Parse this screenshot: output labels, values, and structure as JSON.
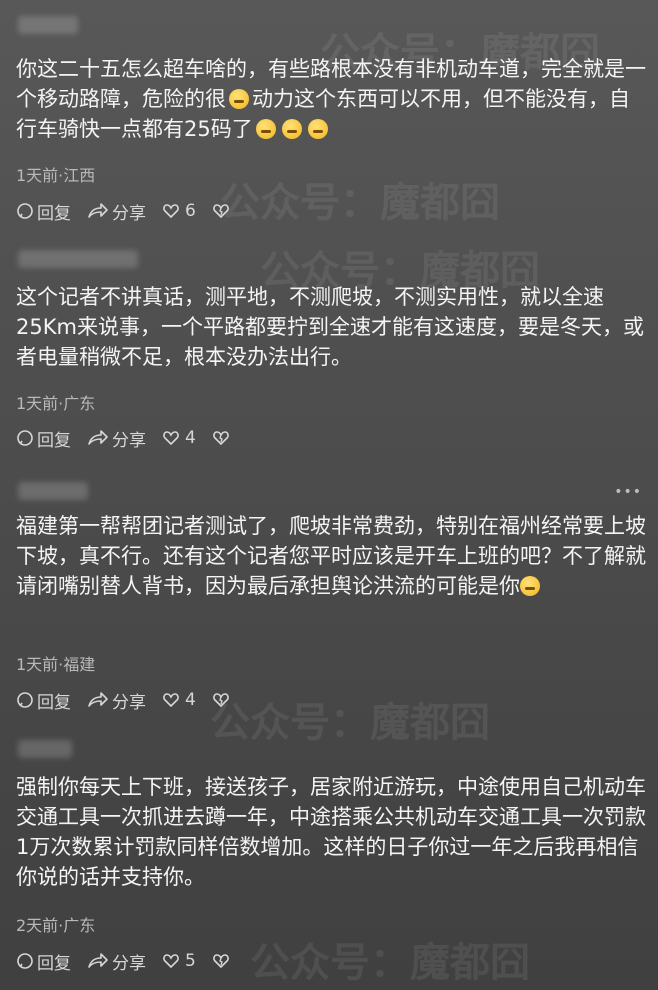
{
  "watermark": "公众号：魔都囧",
  "actions": {
    "reply_label": "回复",
    "share_label": "分享"
  },
  "comments": [
    {
      "text_before": "你这二十五怎么超车啥的，有些路根本没有非机动车道，完全就是一个移动路障，危险的很",
      "text_after": "动力这个东西可以不用，但不能没有，自行车骑快一点都有25码了",
      "meta": "1天前·江西",
      "likes": "6"
    },
    {
      "text": "这个记者不讲真话，测平地，不测爬坡，不测实用性，就以全速25Km来说事，一个平路都要拧到全速才能有这速度，要是冬天，或者电量稍微不足，根本没办法出行。",
      "meta": "1天前·广东",
      "likes": "4"
    },
    {
      "text": "福建第一帮帮团记者测试了，爬坡非常费劲，特别在福州经常要上坡下坡，真不行。还有这个记者您平时应该是开车上班的吧？不了解就请闭嘴别替人背书，因为最后承担舆论洪流的可能是你",
      "meta": "1天前·福建",
      "likes": "4"
    },
    {
      "text": "强制你每天上下班，接送孩子，居家附近游玩，中途使用自己机动车交通工具一次抓进去蹲一年，中途搭乘公共机动车交通工具一次罚款1万次数累计罚款同样倍数增加。这样的日子你过一年之后我再相信你说的话并支持你。",
      "meta": "2天前·广东",
      "likes": "5"
    }
  ]
}
